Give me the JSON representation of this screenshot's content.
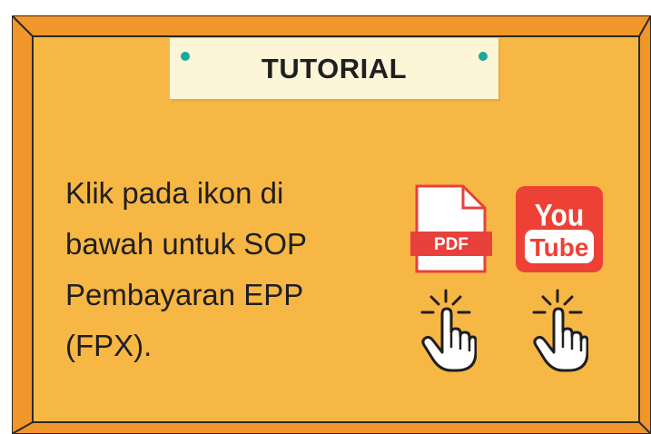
{
  "board": {
    "title": "TUTORIAL",
    "lines": [
      "Klik pada ikon di",
      "bawah untuk SOP",
      "Pembayaran EPP",
      "(FPX)."
    ]
  },
  "icons": {
    "pdf_label": "PDF",
    "youtube_top": "You",
    "youtube_bottom": "Tube"
  },
  "colors": {
    "board": "#f7b745",
    "frame": "#f0962a",
    "note": "#fcf5d8",
    "pin": "#1aa99a",
    "pdf_red": "#e8403a",
    "youtube_red": "#ee4136"
  }
}
